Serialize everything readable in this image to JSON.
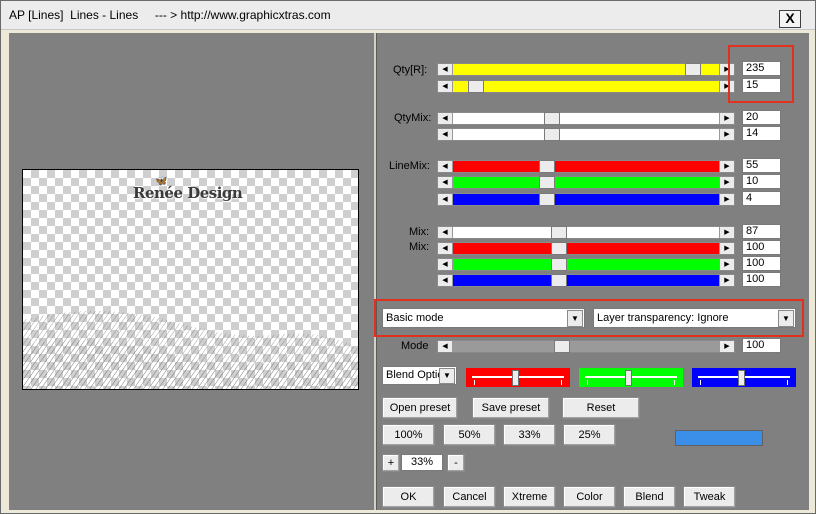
{
  "window": {
    "title": "AP [Lines]  Lines - Lines     --- > http://www.graphicxtras.com",
    "close_label": "X"
  },
  "preview": {
    "logo_text": "Renée Design"
  },
  "labels": {
    "qty": "Qty[R]:",
    "qtymix": "QtyMix:",
    "linemix": "LineMix:",
    "mix1": "Mix:",
    "mix2": "Mix:",
    "mode": "Mode"
  },
  "sliders": {
    "qty_1": {
      "value": "235",
      "color": "#ffff00",
      "level": 0.92
    },
    "qty_2": {
      "value": "15",
      "color": "#ffff00",
      "level": 0.06
    },
    "qtymix_1": {
      "value": "20",
      "color": "#ffffff",
      "level": 0.36
    },
    "qtymix_2": {
      "value": "14",
      "color": "#ffffff",
      "level": 0.36
    },
    "linemix_r": {
      "value": "55",
      "color": "#ff0000",
      "level": 0.34
    },
    "linemix_g": {
      "value": "10",
      "color": "#00ff00",
      "level": 0.34
    },
    "linemix_b": {
      "value": "4",
      "color": "#0000ff",
      "level": 0.34
    },
    "mix_1": {
      "value": "87",
      "color": "#ffffff",
      "level": 0.39
    },
    "mix_r": {
      "value": "100",
      "color": "#ff0000",
      "level": 0.39
    },
    "mix_g": {
      "value": "100",
      "color": "#00ff00",
      "level": 0.39
    },
    "mix_b": {
      "value": "100",
      "color": "#0000ff",
      "level": 0.39
    },
    "mode": {
      "value": "100",
      "color": "#9a9a9a",
      "level": 0.4
    }
  },
  "combos": {
    "mode_select": "Basic mode",
    "transparency_select": "Layer transparency: Ignore",
    "blend_select": "Blend Optio"
  },
  "color_sliders": {
    "red": {
      "color": "#ff0000",
      "level": 0.46
    },
    "green": {
      "color": "#00ff00",
      "level": 0.46
    },
    "blue": {
      "color": "#0000ff",
      "level": 0.46
    }
  },
  "buttons": {
    "open_preset": "Open preset",
    "save_preset": "Save preset",
    "reset": "Reset",
    "zoom_100": "100%",
    "zoom_50": "50%",
    "zoom_33": "33%",
    "zoom_25": "25%",
    "plus": "+",
    "minus": "-",
    "ok": "OK",
    "cancel": "Cancel",
    "xtreme": "Xtreme",
    "color": "Color",
    "blend": "Blend",
    "tweak": "Tweak"
  },
  "zoom_value": "33%",
  "swatch_color": "#3b8fe8",
  "highlight_color": "#e03020"
}
